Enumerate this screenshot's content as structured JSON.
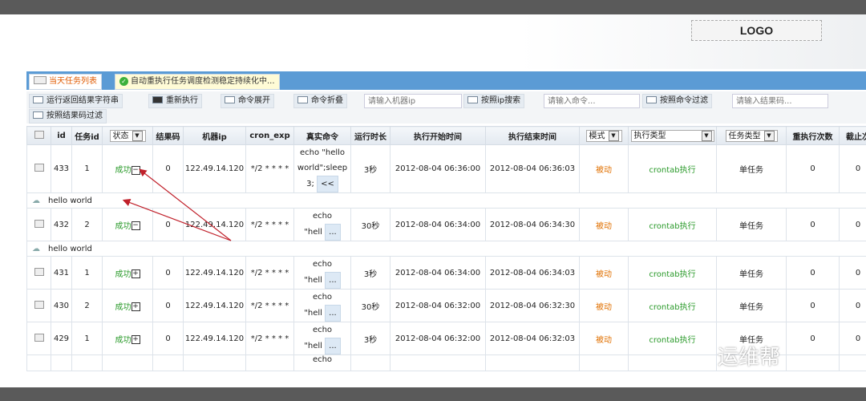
{
  "logo": "LOGO",
  "tabs": [
    {
      "label": "当天任务列表"
    },
    {
      "label": "自动重执行任务调度检测稳定持续化中..."
    }
  ],
  "toolbar": {
    "run_result_string": "运行返回结果字符串",
    "rerun": "重新执行",
    "expand_cmd": "命令展开",
    "collapse_cmd": "命令折叠",
    "ip_placeholder": "请输入机器ip",
    "search_ip": "按照ip搜索",
    "cmd_placeholder": "请输入命令...",
    "filter_cmd": "按照命令过滤",
    "code_placeholder": "请输入结果码...",
    "filter_code": "按照结果码过滤"
  },
  "columns": {
    "id": "id",
    "task_id": "任务id",
    "status": "状态",
    "result": "结果码",
    "ip": "机器ip",
    "cron": "cron_exp",
    "cmd": "真实命令",
    "duration": "运行时长",
    "start": "执行开始时间",
    "end": "执行结束时间",
    "mode": "模式",
    "exec_type": "执行类型",
    "task_type": "任务类型",
    "retry": "重执行次数",
    "stop": "截止次"
  },
  "rows": [
    {
      "id": "433",
      "task_id": "1",
      "status": "成功",
      "expanded": true,
      "result": "0",
      "ip": "122.49.14.120",
      "cron": "*/2 * * * *",
      "cmd": [
        "echo \"hello",
        "world\";sleep",
        "3;"
      ],
      "more": "<<",
      "duration": "3秒",
      "start": "2012-08-04 06:36:00",
      "end": "2012-08-04 06:36:03",
      "mode": "被动",
      "exec_type": "crontab执行",
      "task_type": "单任务",
      "retry": "0",
      "stop": "0",
      "output": "hello world"
    },
    {
      "id": "432",
      "task_id": "2",
      "status": "成功",
      "expanded": true,
      "result": "0",
      "ip": "122.49.14.120",
      "cron": "*/2 * * * *",
      "cmd": [
        "echo",
        "\"hell"
      ],
      "more": "...",
      "duration": "30秒",
      "start": "2012-08-04 06:34:00",
      "end": "2012-08-04 06:34:30",
      "mode": "被动",
      "exec_type": "crontab执行",
      "task_type": "单任务",
      "retry": "0",
      "stop": "0",
      "output": "hello world"
    },
    {
      "id": "431",
      "task_id": "1",
      "status": "成功",
      "expanded": false,
      "result": "0",
      "ip": "122.49.14.120",
      "cron": "*/2 * * * *",
      "cmd": [
        "echo",
        "\"hell"
      ],
      "more": "...",
      "duration": "3秒",
      "start": "2012-08-04 06:34:00",
      "end": "2012-08-04 06:34:03",
      "mode": "被动",
      "exec_type": "crontab执行",
      "task_type": "单任务",
      "retry": "0",
      "stop": "0"
    },
    {
      "id": "430",
      "task_id": "2",
      "status": "成功",
      "expanded": false,
      "result": "0",
      "ip": "122.49.14.120",
      "cron": "*/2 * * * *",
      "cmd": [
        "echo",
        "\"hell"
      ],
      "more": "...",
      "duration": "30秒",
      "start": "2012-08-04 06:32:00",
      "end": "2012-08-04 06:32:30",
      "mode": "被动",
      "exec_type": "crontab执行",
      "task_type": "单任务",
      "retry": "0",
      "stop": "0"
    },
    {
      "id": "429",
      "task_id": "1",
      "status": "成功",
      "expanded": false,
      "result": "0",
      "ip": "122.49.14.120",
      "cron": "*/2 * * * *",
      "cmd": [
        "echo",
        "\"hell"
      ],
      "more": "...",
      "duration": "3秒",
      "start": "2012-08-04 06:32:00",
      "end": "2012-08-04 06:32:03",
      "mode": "被动",
      "exec_type": "crontab执行",
      "task_type": "单任务",
      "retry": "0",
      "stop": "0"
    }
  ],
  "partial_row_cmd": "echo",
  "watermark": "运维帮",
  "colors": {
    "tab_bar": "#5b9bd5",
    "success": "#2a9a2a",
    "mode": "#e07000",
    "arrow": "#c0202a"
  }
}
